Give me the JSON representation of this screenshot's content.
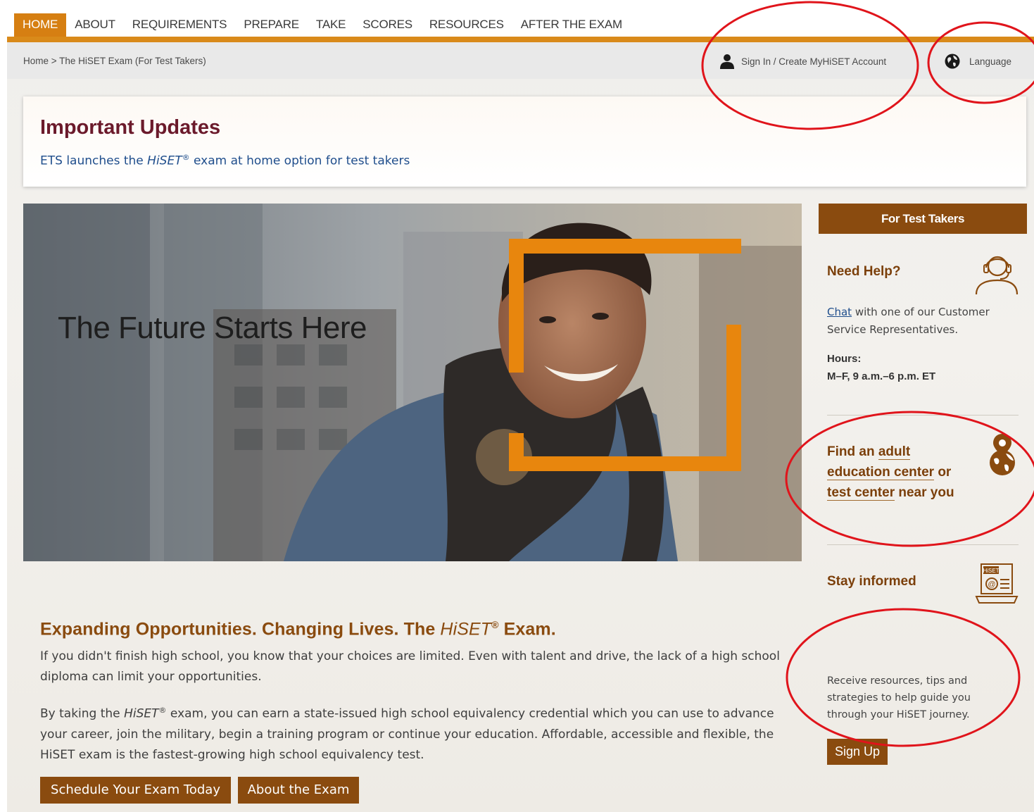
{
  "topnav": {
    "items": [
      "HOME",
      "ABOUT",
      "REQUIREMENTS",
      "PREPARE",
      "TAKE",
      "SCORES",
      "RESOURCES",
      "AFTER THE EXAM"
    ]
  },
  "breadcrumb": "Home > The HiSET Exam (For Test Takers)",
  "account": {
    "signin_label": "Sign In / Create MyHiSET Account",
    "language_label": "Language"
  },
  "updates": {
    "title": "Important Updates",
    "link_prefix": "ETS launches the ",
    "link_brand": "HiSET",
    "link_reg": "®",
    "link_suffix": " exam at home option for test takers"
  },
  "hero": {
    "title": "The Future Starts Here"
  },
  "sidebar": {
    "header": "For Test Takers",
    "help_title": "Need Help?",
    "chat_link": "Chat",
    "chat_text": " with one of our Customer Service Representatives.",
    "hours_label": "Hours:",
    "hours_value": "M–F, 9 a.m.–6 p.m. ET",
    "find_prefix": "Find an ",
    "find_link1": "adult education center",
    "find_mid": " or ",
    "find_link2": "test center",
    "find_suffix": " near you",
    "stay_title": "Stay informed",
    "stay_text": "Receive resources, tips and strategies to help guide you through your HiSET journey.",
    "signup_label": "Sign Up",
    "newsletter_icon_text": "HiSET"
  },
  "main": {
    "heading_prefix": "Expanding Opportunities. Changing Lives. The ",
    "heading_brand": "HiSET",
    "heading_reg": "®",
    "heading_suffix": " Exam.",
    "para1": "If you didn't finish high school, you know that your choices are limited. Even with talent and drive, the lack of a high school diploma can limit your opportunities.",
    "para2_prefix": "By taking the ",
    "para2_brand": "HiSET",
    "para2_reg": "®",
    "para2_suffix": " exam, you can earn a state-issued high school equivalency credential which you can use to advance your career, join the military, begin a training program or continue your education. Affordable, accessible and flexible, the HiSET exam is the fastest-growing high school equivalency test.",
    "btn_schedule": "Schedule Your Exam Today",
    "btn_about": "About the Exam"
  },
  "colors": {
    "accent_orange": "#d67f12",
    "brand_brown": "#8a4b0f",
    "heading_maroon": "#6b1a2b",
    "link_blue": "#1f4e8c",
    "annotation_red": "#e0141b"
  }
}
